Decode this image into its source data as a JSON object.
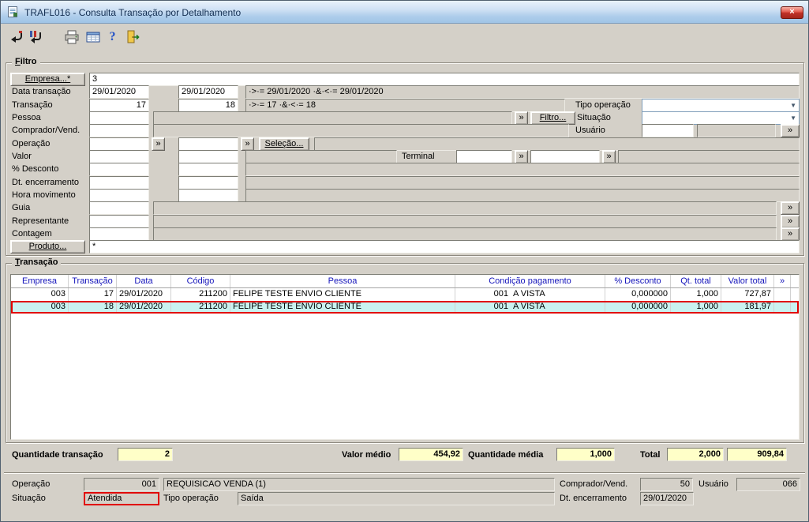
{
  "colors": {
    "window_bg": "#d4d0c8",
    "titlebar_gradient_top": "#e9f2fb",
    "titlebar_gradient_bottom": "#a0c4e6",
    "highlight_red": "#e10000",
    "selected_row_bg": "#c9f2f0",
    "grid_header_text": "#1414bb",
    "summary_field_bg": "#ffffc8"
  },
  "window": {
    "title": "TRAFL016 - Consulta Transação por Detalhamento",
    "close_glyph": "×"
  },
  "toolbar": {
    "icons": [
      "return-arrow-icon",
      "return-all-arrow-icon",
      "print-icon",
      "grid-icon",
      "help-icon",
      "exit-door-icon"
    ]
  },
  "filter": {
    "caption": "Filtro",
    "empresa_button": "Empresa...*",
    "empresa_value": "3",
    "lookup_glyph": "»",
    "filtro_button": "Filtro...",
    "selecao_button": "Seleção...",
    "produto_button": "Produto...",
    "produto_value": "*",
    "terminal_label": "Terminal",
    "tipo_operacao_label": "Tipo operação",
    "situacao_label": "Situação",
    "usuario_label": "Usuário",
    "rows": {
      "data_transacao": {
        "label": "Data transação",
        "from": "29/01/2020",
        "to": "29/01/2020",
        "expr": "·>·= 29/01/2020 ·&·<·= 29/01/2020"
      },
      "transacao": {
        "label": "Transação",
        "from": "17",
        "to": "18",
        "expr": "·>·= 17 ·&·<·= 18"
      },
      "pessoa": {
        "label": "Pessoa"
      },
      "comprador": {
        "label": "Comprador/Vend."
      },
      "operacao": {
        "label": "Operação"
      },
      "valor": {
        "label": "Valor"
      },
      "desconto": {
        "label": "% Desconto"
      },
      "dt_encerramento": {
        "label": "Dt. encerramento"
      },
      "hora_movimento": {
        "label": "Hora movimento"
      },
      "guia": {
        "label": "Guia"
      },
      "representante": {
        "label": "Representante"
      },
      "contagem": {
        "label": "Contagem"
      }
    }
  },
  "grid": {
    "caption": "Transação",
    "columns": [
      "Empresa",
      "Transação",
      "Data",
      "Código",
      "Pessoa",
      "Condição pagamento",
      "% Desconto",
      "Qt. total",
      "Valor total",
      "»"
    ],
    "rows": [
      {
        "empresa": "003",
        "transacao": "17",
        "data": "29/01/2020",
        "codigo": "211200",
        "pessoa": "FELIPE TESTE ENVIO CLIENTE",
        "cond_codigo": "001",
        "cond_desc": "A VISTA",
        "desconto": "0,000000",
        "qt_total": "1,000",
        "valor_total": "727,87"
      },
      {
        "empresa": "003",
        "transacao": "18",
        "data": "29/01/2020",
        "codigo": "211200",
        "pessoa": "FELIPE TESTE ENVIO CLIENTE",
        "cond_codigo": "001",
        "cond_desc": "A VISTA",
        "desconto": "0,000000",
        "qt_total": "1,000",
        "valor_total": "181,97"
      }
    ]
  },
  "summary": {
    "quantidade_label": "Quantidade transação",
    "quantidade_value": "2",
    "valor_medio_label": "Valor médio",
    "valor_medio_value": "454,92",
    "quantidade_media_label": "Quantidade média",
    "quantidade_media_value": "1,000",
    "total_label": "Total",
    "total_qt": "2,000",
    "total_valor": "909,84"
  },
  "detail": {
    "operacao_label": "Operação",
    "operacao_codigo": "001",
    "operacao_descricao": "REQUISICAO VENDA (1)",
    "comprador_label": "Comprador/Vend.",
    "comprador_value": "50",
    "usuario_label": "Usuário",
    "usuario_value": "066",
    "situacao_label": "Situação",
    "situacao_value": "Atendida",
    "tipo_operacao_label": "Tipo operação",
    "tipo_operacao_value": "Saída",
    "dt_encerramento_label": "Dt. encerramento",
    "dt_encerramento_value": "29/01/2020"
  }
}
